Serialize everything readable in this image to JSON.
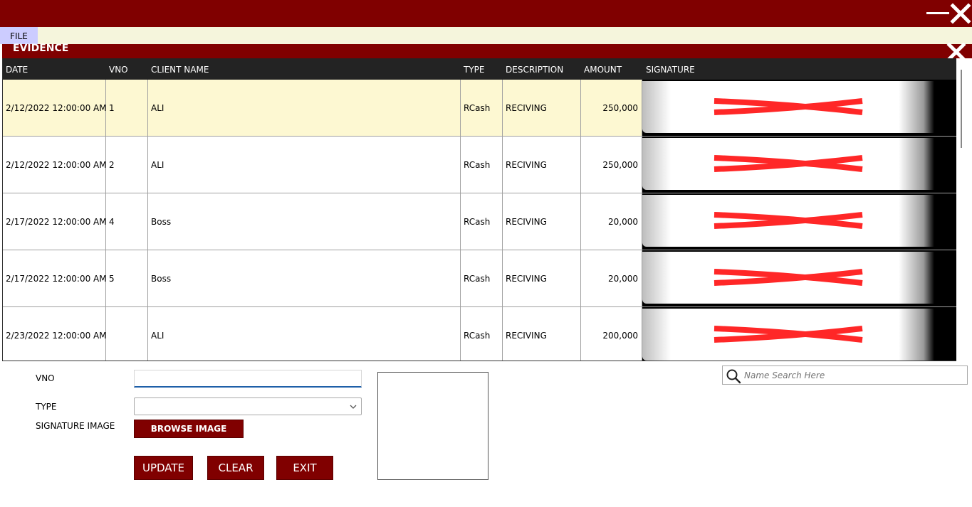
{
  "window": {
    "minimize_icon": "minimize-icon",
    "close_icon": "close-icon",
    "accent_color": "#800000"
  },
  "menu": {
    "file_label": "FILE"
  },
  "panel": {
    "title": "EVIDENCE",
    "close_icon": "close-icon"
  },
  "grid": {
    "columns": [
      "DATE",
      "VNO",
      "CLIENT NAME",
      "TYPE",
      "DESCRIPTION",
      "AMOUNT",
      "SIGNATURE"
    ],
    "rows": [
      {
        "date": "2/12/2022 12:00:00 AM",
        "vno": "1",
        "client": "ALI",
        "type": "RCash",
        "description": "RECIVING",
        "amount": "250,000"
      },
      {
        "date": "2/12/2022 12:00:00 AM",
        "vno": "2",
        "client": "ALI",
        "type": "RCash",
        "description": "RECIVING",
        "amount": "250,000"
      },
      {
        "date": "2/17/2022 12:00:00 AM",
        "vno": "4",
        "client": "Boss",
        "type": "RCash",
        "description": "RECIVING",
        "amount": "20,000"
      },
      {
        "date": "2/17/2022 12:00:00 AM",
        "vno": "5",
        "client": "Boss",
        "type": "RCash",
        "description": "RECIVING",
        "amount": "20,000"
      },
      {
        "date": "2/23/2022 12:00:00 AM",
        "vno": "",
        "client": "ALI",
        "type": "RCash",
        "description": "RECIVING",
        "amount": "200,000"
      }
    ],
    "selected_row_color": "#fdf8d2"
  },
  "form": {
    "vno_label": "VNO",
    "vno_value": "",
    "type_label": "TYPE",
    "type_value": "",
    "signature_label": "SIGNATURE IMAGE",
    "browse_label": "BROWSE IMAGE",
    "update_label": "UPDATE",
    "clear_label": "CLEAR",
    "exit_label": "EXIT"
  },
  "search": {
    "placeholder": "Name Search Here",
    "icon": "search-icon"
  }
}
